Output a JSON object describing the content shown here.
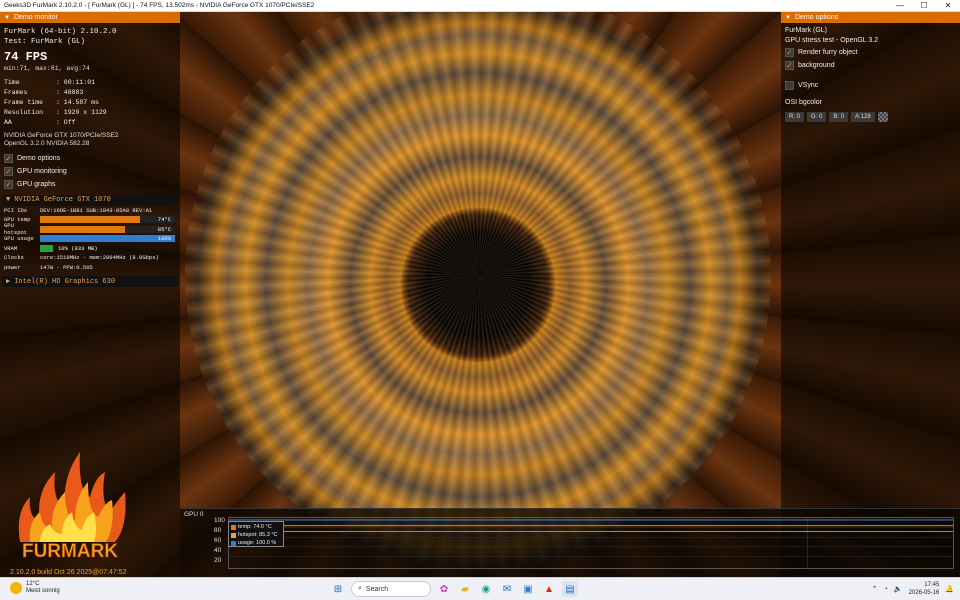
{
  "window": {
    "title": "Geeks3D FurMark 2.10.2.0 - [ FurMark (GL) ] - 74 FPS, 13.502ms - NVIDIA GeForce GTX 1070/PCIe/SSE2"
  },
  "left_panel": {
    "header": "Demo monitor",
    "app_line": "FurMark (64-bit) 2.10.2.0",
    "test_line": "Test: FurMark (GL)",
    "fps": "74 FPS",
    "fps_stats": "min:71, max:81, avg:74",
    "stats": [
      {
        "k": "Time",
        "v": ": 00:11:01"
      },
      {
        "k": "Frames",
        "v": ": 48883"
      },
      {
        "k": "Frame time",
        "v": ": 14.587 ms"
      },
      {
        "k": "Resolution",
        "v": ": 1920 x 1129"
      },
      {
        "k": "AA",
        "v": ": Off"
      }
    ],
    "renderer": "NVIDIA GeForce GTX 1070/PCIe/SSE2",
    "opengl": "OpenGL 3.2.0 NVIDIA 582.28",
    "checkboxes": [
      {
        "label": "Demo options",
        "checked": true
      },
      {
        "label": "GPU monitoring",
        "checked": true
      },
      {
        "label": "GPU graphs",
        "checked": true
      }
    ],
    "gpu": {
      "name": "NVIDIA GeForce GTX 1070",
      "pci_k": "PCI IDs",
      "pci_v": "DEV:10DE-1B81 SUB:1043-85A0 REV:A1",
      "temp_k": "GPU temp",
      "temp_v": "74°C",
      "temp_frac": 0.74,
      "hotspot_k": "GPU hotspot",
      "hotspot_v": "85°C",
      "hotspot_frac": 0.63,
      "usage_k": "GPU usage",
      "usage_v": "100%",
      "usage_frac": 1.0,
      "vram_k": "VRAM",
      "vram_v": "10% (833 MB)",
      "vram_frac": 0.1,
      "clocks_k": "Clocks",
      "clocks_v": "core:1519MHz - mem:2004MHz (8.0Gbps)",
      "power_k": "power",
      "power_v": "147W - PPW:0.505"
    },
    "gpu2": {
      "name": "Intel(R) HD Graphics 630"
    },
    "logo_text": "FURMARK",
    "build": "2.10.2.0 build Oct 26 2025@07:47:52"
  },
  "right_panel": {
    "header": "Demo options",
    "demo": "FurMark (GL)",
    "desc": "GPU stress test - OpenGL 3.2",
    "opts": [
      {
        "label": "Render furry object",
        "checked": true
      },
      {
        "label": "background",
        "checked": true
      }
    ],
    "vsync": {
      "label": "VSync",
      "checked": false
    },
    "bgcolor_label": "OSI bgcolor",
    "rgba": [
      "R: 0",
      "G: 0",
      "B: 0",
      "A:128"
    ]
  },
  "graph": {
    "label": "GPU 0",
    "ticks": [
      "100",
      "80",
      "60",
      "40",
      "20"
    ],
    "legend": [
      {
        "label": "temp: 74.0 °C",
        "color": "#e07a10"
      },
      {
        "label": "hotspot: 85.3 °C",
        "color": "#f0a030"
      },
      {
        "label": "usage: 100.0 %",
        "color": "#2f7fd0"
      }
    ]
  },
  "taskbar": {
    "weather_temp": "12°C",
    "weather_desc": "Meist sonnig",
    "search": "Search",
    "time": "17:45",
    "date": "2026-05-16"
  }
}
